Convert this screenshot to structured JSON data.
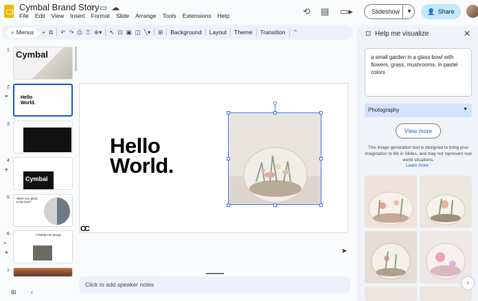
{
  "app": {
    "doc_title": "Cymbal Brand Story",
    "menu": [
      "File",
      "Edit",
      "View",
      "Insert",
      "Format",
      "Slide",
      "Arrange",
      "Tools",
      "Extensions",
      "Help"
    ],
    "slideshow_label": "Slideshow",
    "share_label": "Share"
  },
  "toolbar": {
    "menus_label": "Menus",
    "background_label": "Background",
    "layout_label": "Layout",
    "theme_label": "Theme",
    "transition_label": "Transition"
  },
  "filmstrip": {
    "slides": [
      {
        "num": "1",
        "text": "Cymbal"
      },
      {
        "num": "2",
        "text": "Hello World."
      },
      {
        "num": "3",
        "text": ""
      },
      {
        "num": "4",
        "text": "Cymbal"
      },
      {
        "num": "5",
        "text": "Seem too good to be true?"
      },
      {
        "num": "6",
        "text": "A family-run group."
      },
      {
        "num": "7",
        "text": ""
      }
    ]
  },
  "slide": {
    "headline_line1": "Hello",
    "headline_line2": "World.",
    "logo_text": "CC"
  },
  "notes": {
    "placeholder": "Click to add speaker notes"
  },
  "panel": {
    "title": "Help me visualize",
    "prompt": "a small garden in a glass bowl with flowers, grass, mushrooms, in pastel colors",
    "style": "Photography",
    "view_more": "View more",
    "disclaimer": "This image generation tool is designed to bring your imagination to life in Slides, and may not represent real world situations.",
    "learn_more": "Learn more"
  },
  "colors": {
    "accent": "#0b57d0",
    "share_bg": "#c2e7ff",
    "panel_bg": "#f0f4f9",
    "select_bg": "#d3e3fd"
  }
}
